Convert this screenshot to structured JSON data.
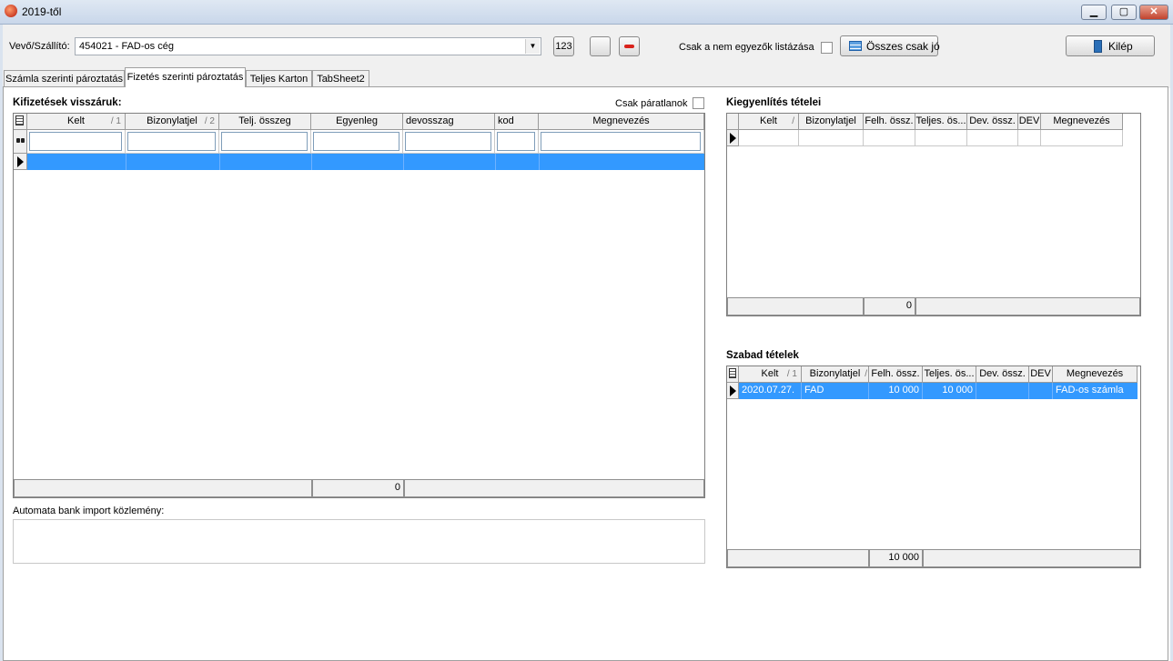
{
  "window": {
    "title": "2019-től",
    "min": "▁",
    "max": "▢",
    "close": "✕"
  },
  "toolbar": {
    "partner_label": "Vevő/Szállító:",
    "partner_value": "454021 - FAD-os cég",
    "btn_123": "123",
    "only_mismatch_label": "Csak a nem egyezők listázása",
    "all_ok_label": "Összes csak jó",
    "exit_label": "Kilép"
  },
  "tabs": [
    {
      "label": "Számla szerinti pároztatás"
    },
    {
      "label": "Fizetés szerinti pároztatás"
    },
    {
      "label": "Teljes Karton"
    },
    {
      "label": "TabSheet2"
    }
  ],
  "payments": {
    "title": "Kifizetések visszáruk:",
    "odd_only_label": "Csak páratlanok",
    "columns": [
      "Kelt",
      "Bizonylatjel",
      "Telj. összeg",
      "Egyenleg",
      "devosszag",
      "kod",
      "Megnevezés"
    ],
    "sort_marks": [
      "/ 1",
      "/ 2"
    ],
    "footer_total": "0"
  },
  "bank_import": {
    "label": "Automata bank import közlemény:"
  },
  "settlement": {
    "title": "Kiegyenlítés tételei",
    "columns": [
      "Kelt",
      "Bizonylatjel",
      "Felh. össz.",
      "Teljes. ös...",
      "Dev. össz.",
      "DEV",
      "Megnevezés"
    ],
    "sort_mark": "/",
    "footer_total": "0"
  },
  "free_items": {
    "title": "Szabad tételek",
    "columns": [
      "Kelt",
      "Bizonylatjel",
      "Felh. össz.",
      "Teljes. ös...",
      "Dev. össz.",
      "DEV",
      "Megnevezés"
    ],
    "sort_marks": [
      "/ 1",
      "/"
    ],
    "rows": [
      {
        "kelt": "2020.07.27.",
        "bizonylatjel": "FAD",
        "felh_ossz": "10 000",
        "teljes_ossz": "10 000",
        "dev_ossz": "",
        "dev": "",
        "megnevezes": "FAD-os számla"
      }
    ],
    "footer_total": "10 000"
  },
  "colors": {
    "selection": "#3399ff",
    "title_bar": "#c9d7ea",
    "button_minus": "#d9231c"
  },
  "icons": [
    "app-icon",
    "dropdown-arrow-icon",
    "minus-icon",
    "table-icon",
    "exit-door-icon",
    "binoculars-icon",
    "row-indicator-icon"
  ]
}
